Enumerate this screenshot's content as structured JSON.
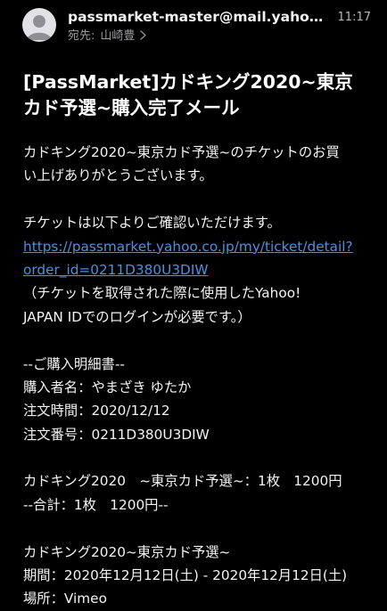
{
  "header": {
    "sender": "passmarket-master@mail.yahoo....",
    "time": "11:17",
    "to_label": "宛先:",
    "to_name": "山崎豊"
  },
  "subject_lines": [
    "[PassMarket]カドキング2020~東京",
    "カド予選~購入完了メール"
  ],
  "body": {
    "intro": [
      "カドキング2020~東京カド予選~のチケットのお買",
      "い上げありがとうございます。"
    ],
    "confirm": "チケットは以下よりご確認いただけます。",
    "link": [
      "https://passmarket.yahoo.co.jp/my/ticket/detail?",
      "order_id=0211D380U3DIW"
    ],
    "note": [
      "（チケットを取得された際に使用したYahoo!",
      "JAPAN IDでのログインが必要です。）"
    ],
    "receipt_header": "--ご購入明細書--",
    "purchaser": "購入者名：やまざき ゆたか",
    "order_time": "注文時間：2020/12/12",
    "order_number": "注文番号：0211D380U3DIW",
    "item_line": "カドキング2020　~東京カド予選~：1枚　1200円",
    "total_line": "--合計：1枚　1200円--",
    "event_name": "カドキング2020~東京カド予選~",
    "period": "期間：2020年12月12日(土) - 2020年12月12日(土)",
    "venue": "場所：Vimeo"
  },
  "colors": {
    "background": "#000000",
    "text": "#ffffff",
    "link": "#4f8fe0",
    "secondary": "#9a9a9f"
  },
  "icons": {
    "avatar": "person-avatar-icon",
    "chevron": "chevron-right-icon"
  }
}
